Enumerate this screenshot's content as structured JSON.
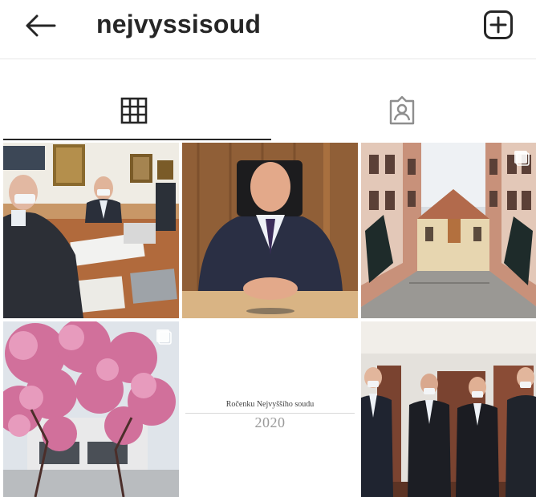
{
  "header": {
    "username": "nejvyssisoud",
    "back_icon": "arrow-left-icon",
    "new_post_icon": "plus-square-icon"
  },
  "tabs": [
    {
      "name": "posts-grid",
      "icon": "grid-icon",
      "active": true
    },
    {
      "name": "tagged",
      "icon": "tagged-user-icon",
      "active": false
    }
  ],
  "posts": [
    {
      "subject": "office-meeting",
      "multi": false
    },
    {
      "subject": "portrait",
      "multi": false
    },
    {
      "subject": "court-building",
      "multi": true
    },
    {
      "subject": "cherry-blossom",
      "multi": true
    },
    {
      "subject": "yearbook-cover",
      "multi": false,
      "title": "Ročenku Nejvyššího soudu",
      "year": "2020"
    },
    {
      "subject": "group-photo",
      "multi": false
    }
  ],
  "colors": {
    "text": "#262626",
    "divider": "#e6e6e6",
    "accent_tab": "#262626"
  }
}
